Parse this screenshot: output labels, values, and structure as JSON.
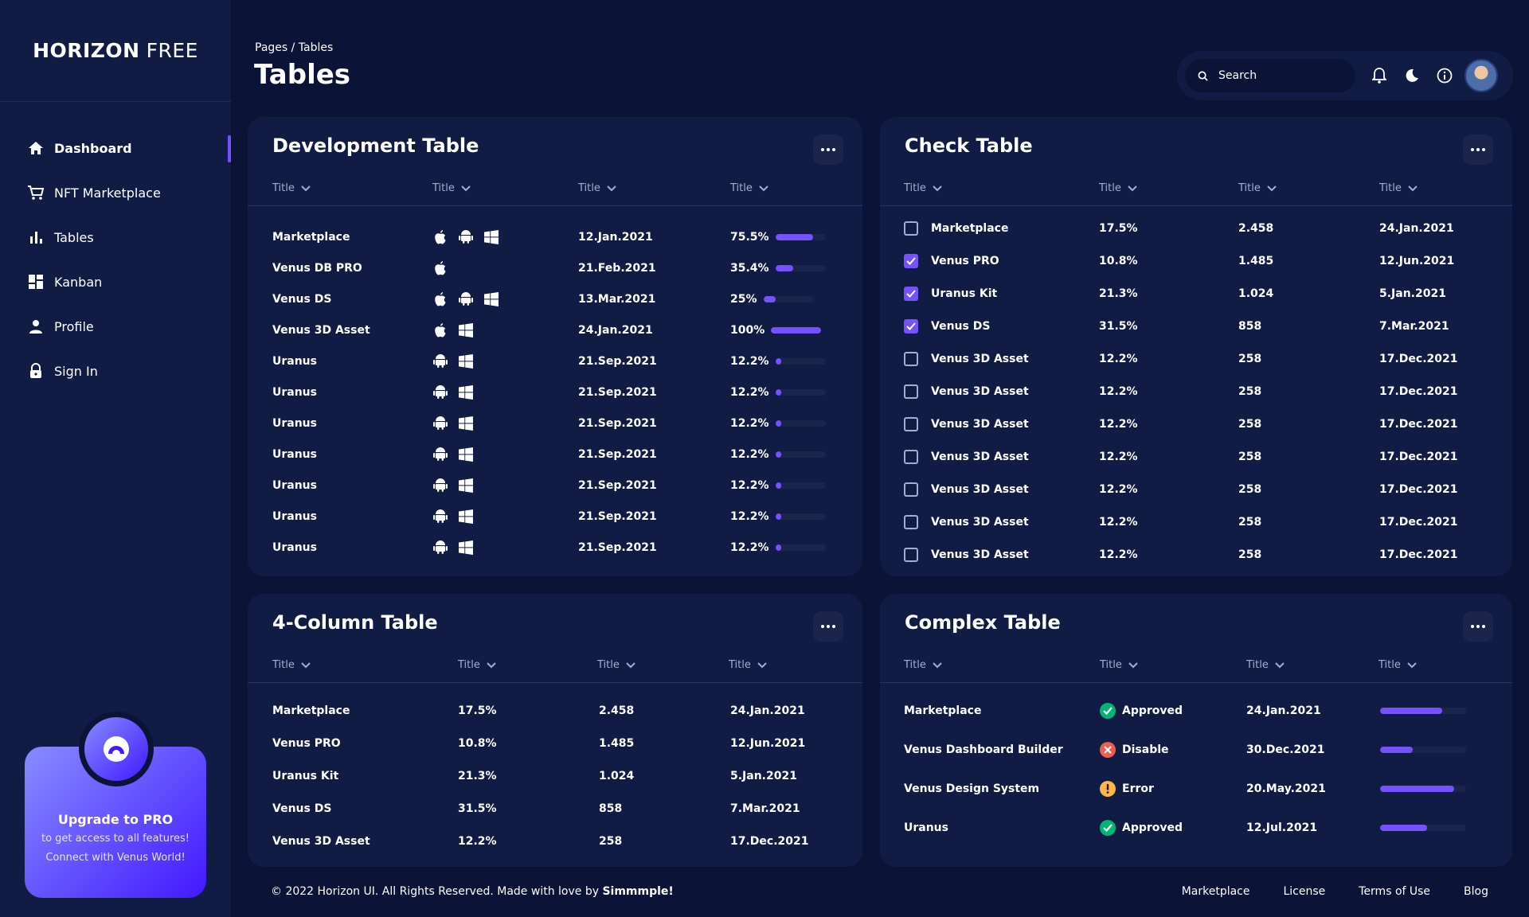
{
  "brand": {
    "bold": "HORIZON",
    "light": "FREE"
  },
  "sidebar": {
    "items": [
      {
        "label": "Dashboard",
        "icon": "home-icon"
      },
      {
        "label": "NFT Marketplace",
        "icon": "cart-icon"
      },
      {
        "label": "Tables",
        "icon": "bar-chart-icon"
      },
      {
        "label": "Kanban",
        "icon": "grid-icon"
      },
      {
        "label": "Profile",
        "icon": "person-icon"
      },
      {
        "label": "Sign In",
        "icon": "lock-icon"
      }
    ],
    "active_index": 0
  },
  "promo": {
    "title": "Upgrade to PRO",
    "line1": "to get access to all features!",
    "line2": "Connect with Venus World!"
  },
  "header": {
    "breadcrumb": "Pages / Tables",
    "title": "Tables"
  },
  "search": {
    "placeholder": "Search"
  },
  "dev_table": {
    "title": "Development Table",
    "headers": [
      "Title",
      "Title",
      "Title",
      "Title"
    ],
    "rows": [
      {
        "name": "Marketplace",
        "os": [
          "apple",
          "android",
          "windows"
        ],
        "date": "12.Jan.2021",
        "progress": "75.5%",
        "value": 75.5
      },
      {
        "name": "Venus DB PRO",
        "os": [
          "apple"
        ],
        "date": "21.Feb.2021",
        "progress": "35.4%",
        "value": 35.4
      },
      {
        "name": "Venus DS",
        "os": [
          "apple",
          "android",
          "windows"
        ],
        "date": "13.Mar.2021",
        "progress": "25%",
        "value": 25
      },
      {
        "name": "Venus 3D Asset",
        "os": [
          "apple",
          "windows"
        ],
        "date": "24.Jan.2021",
        "progress": "100%",
        "value": 100
      },
      {
        "name": "Uranus",
        "os": [
          "android",
          "windows"
        ],
        "date": "21.Sep.2021",
        "progress": "12.2%",
        "value": 12.2
      },
      {
        "name": "Uranus",
        "os": [
          "android",
          "windows"
        ],
        "date": "21.Sep.2021",
        "progress": "12.2%",
        "value": 12.2
      },
      {
        "name": "Uranus",
        "os": [
          "android",
          "windows"
        ],
        "date": "21.Sep.2021",
        "progress": "12.2%",
        "value": 12.2
      },
      {
        "name": "Uranus",
        "os": [
          "android",
          "windows"
        ],
        "date": "21.Sep.2021",
        "progress": "12.2%",
        "value": 12.2
      },
      {
        "name": "Uranus",
        "os": [
          "android",
          "windows"
        ],
        "date": "21.Sep.2021",
        "progress": "12.2%",
        "value": 12.2
      },
      {
        "name": "Uranus",
        "os": [
          "android",
          "windows"
        ],
        "date": "21.Sep.2021",
        "progress": "12.2%",
        "value": 12.2
      },
      {
        "name": "Uranus",
        "os": [
          "android",
          "windows"
        ],
        "date": "21.Sep.2021",
        "progress": "12.2%",
        "value": 12.2
      }
    ]
  },
  "check_table": {
    "title": "Check Table",
    "headers": [
      "Title",
      "Title",
      "Title",
      "Title"
    ],
    "rows": [
      {
        "checked": false,
        "name": "Marketplace",
        "progress": "17.5%",
        "quantity": "2.458",
        "date": "24.Jan.2021"
      },
      {
        "checked": true,
        "name": "Venus PRO",
        "progress": "10.8%",
        "quantity": "1.485",
        "date": "12.Jun.2021"
      },
      {
        "checked": true,
        "name": "Uranus Kit",
        "progress": "21.3%",
        "quantity": "1.024",
        "date": "5.Jan.2021"
      },
      {
        "checked": true,
        "name": "Venus DS",
        "progress": "31.5%",
        "quantity": "858",
        "date": "7.Mar.2021"
      },
      {
        "checked": false,
        "name": "Venus 3D Asset",
        "progress": "12.2%",
        "quantity": "258",
        "date": "17.Dec.2021"
      },
      {
        "checked": false,
        "name": "Venus 3D Asset",
        "progress": "12.2%",
        "quantity": "258",
        "date": "17.Dec.2021"
      },
      {
        "checked": false,
        "name": "Venus 3D Asset",
        "progress": "12.2%",
        "quantity": "258",
        "date": "17.Dec.2021"
      },
      {
        "checked": false,
        "name": "Venus 3D Asset",
        "progress": "12.2%",
        "quantity": "258",
        "date": "17.Dec.2021"
      },
      {
        "checked": false,
        "name": "Venus 3D Asset",
        "progress": "12.2%",
        "quantity": "258",
        "date": "17.Dec.2021"
      },
      {
        "checked": false,
        "name": "Venus 3D Asset",
        "progress": "12.2%",
        "quantity": "258",
        "date": "17.Dec.2021"
      },
      {
        "checked": false,
        "name": "Venus 3D Asset",
        "progress": "12.2%",
        "quantity": "258",
        "date": "17.Dec.2021"
      }
    ]
  },
  "four_col_table": {
    "title": "4-Column Table",
    "headers": [
      "Title",
      "Title",
      "Title",
      "Title"
    ],
    "rows": [
      {
        "name": "Marketplace",
        "progress": "17.5%",
        "quantity": "2.458",
        "date": "24.Jan.2021"
      },
      {
        "name": "Venus PRO",
        "progress": "10.8%",
        "quantity": "1.485",
        "date": "12.Jun.2021"
      },
      {
        "name": "Uranus Kit",
        "progress": "21.3%",
        "quantity": "1.024",
        "date": "5.Jan.2021"
      },
      {
        "name": "Venus DS",
        "progress": "31.5%",
        "quantity": "858",
        "date": "7.Mar.2021"
      },
      {
        "name": "Venus 3D Asset",
        "progress": "12.2%",
        "quantity": "258",
        "date": "17.Dec.2021"
      }
    ]
  },
  "complex_table": {
    "title": "Complex Table",
    "headers": [
      "Title",
      "Title",
      "Title",
      "Title"
    ],
    "rows": [
      {
        "name": "Marketplace",
        "status": "Approved",
        "status_type": "approved",
        "date": "24.Jan.2021",
        "progress": 72
      },
      {
        "name": "Venus Dashboard Builder",
        "status": "Disable",
        "status_type": "disable",
        "date": "30.Dec.2021",
        "progress": 38
      },
      {
        "name": "Venus Design System",
        "status": "Error",
        "status_type": "error",
        "date": "20.May.2021",
        "progress": 86
      },
      {
        "name": "Uranus",
        "status": "Approved",
        "status_type": "approved",
        "date": "12.Jul.2021",
        "progress": 55
      }
    ]
  },
  "footer": {
    "copyright": "© 2022 Horizon UI. All Rights Reserved. Made with love by",
    "author": "Simmmple!",
    "links": [
      "Marketplace",
      "License",
      "Terms of Use",
      "Blog"
    ]
  },
  "colors": {
    "background": "#0b1437",
    "card": "#111c44",
    "accent": "#7551ff",
    "approved": "#01b574",
    "disable": "#ee5d50",
    "error": "#ffb547",
    "muted": "#a3aed0"
  }
}
